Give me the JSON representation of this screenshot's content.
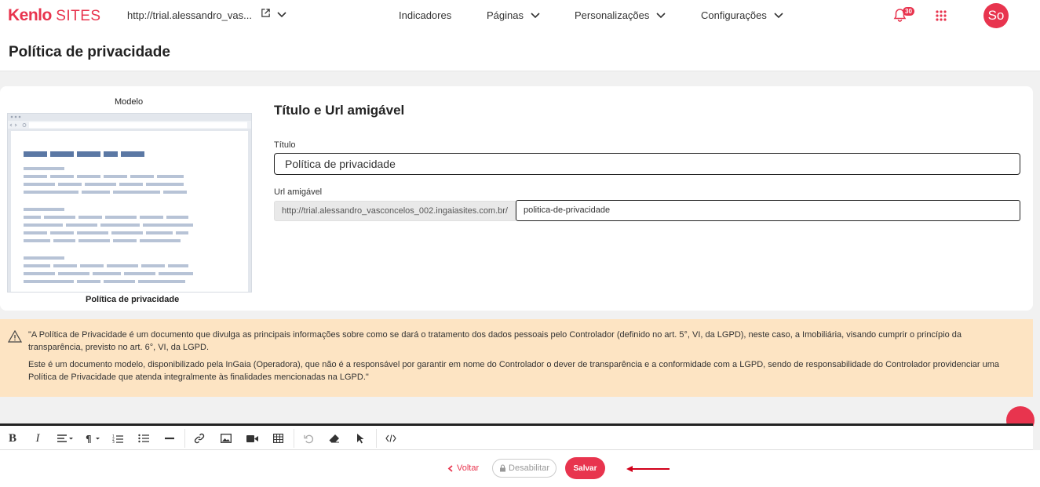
{
  "brand": {
    "logo_main": "Kenlo",
    "logo_suffix": "SITES",
    "accent_color": "#e8344e"
  },
  "navbar": {
    "site_url": "http://trial.alessandro_vas...",
    "items": [
      {
        "label": "Indicadores",
        "has_dropdown": false
      },
      {
        "label": "Páginas",
        "has_dropdown": true
      },
      {
        "label": "Personalizações",
        "has_dropdown": true
      },
      {
        "label": "Configurações",
        "has_dropdown": true
      }
    ],
    "notifications_count": "30",
    "avatar_initials": "So",
    "icons": [
      "external-link-icon",
      "chevron-down-icon",
      "bell-icon",
      "apps-grid-icon"
    ]
  },
  "page": {
    "title": "Política de privacidade"
  },
  "model": {
    "label": "Modelo",
    "template_name": "Política de privacidade"
  },
  "form": {
    "section_title": "Título e Url amigável",
    "title_label": "Título",
    "title_value": "Política de privacidade",
    "url_label": "Url amigável",
    "url_prefix": "http://trial.alessandro_vasconcelos_002.ingaiasites.com.br/",
    "url_slug": "politica-de-privacidade"
  },
  "warning": {
    "paragraph1": "\"A Política de Privacidade é um documento que divulga as principais informações sobre como se dará o tratamento dos dados pessoais pelo Controlador (definido no art. 5°, VI, da LGPD), neste caso, a Imobiliária, visando cumprir o princípio da transparência, previsto no art. 6°, VI, da LGPD.",
    "paragraph2": "Este é um documento modelo, disponibilizado pela InGaia (Operadora), que não é a responsável por garantir em nome do Controlador o dever de transparência e a conformidade com a LGPD, sendo de responsabilidade do Controlador providenciar uma Política de Privacidade que atenda integralmente às finalidades mencionadas na LGPD.\"",
    "icon": "warning-triangle-icon"
  },
  "toolbar": {
    "bold": "B",
    "italic": "I",
    "icons": [
      "align-icon",
      "paragraph-icon",
      "ordered-list-icon",
      "unordered-list-icon",
      "horizontal-rule-icon",
      "link-icon",
      "image-icon",
      "video-icon",
      "table-icon",
      "undo-icon",
      "eraser-icon",
      "cursor-icon",
      "code-view-icon"
    ]
  },
  "actions": {
    "back_label": "Voltar",
    "disable_label": "Desabilitar",
    "save_label": "Salvar"
  }
}
